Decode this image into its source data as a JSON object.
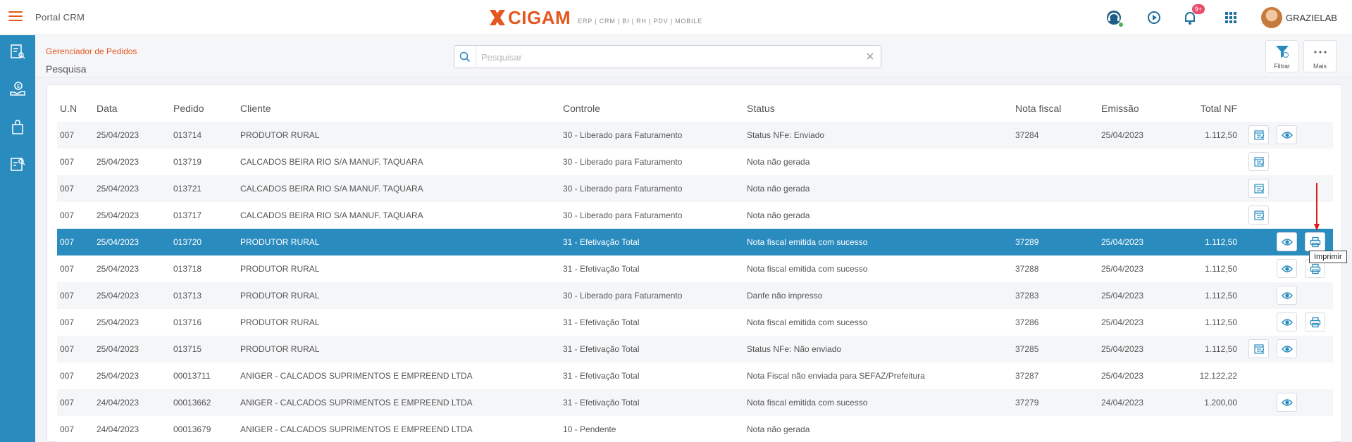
{
  "app": {
    "title": "Portal CRM",
    "brand": "CIGAM",
    "brand_tagline": "ERP | CRM | BI | RH | PDV | MOBILE",
    "accent": "#e4571e",
    "primary": "#2a8bbf"
  },
  "topbar": {
    "notifications_count": "9+",
    "user_name": "GRAZIELAB"
  },
  "header": {
    "breadcrumb": "Gerenciador de Pedidos",
    "title": "Pesquisa",
    "search_placeholder": "Pesquisar",
    "search_value": "",
    "filter_label": "Filtrar",
    "more_label": "Mais"
  },
  "table": {
    "columns": [
      "U.N",
      "Data",
      "Pedido",
      "Cliente",
      "Controle",
      "Status",
      "Nota fiscal",
      "Emissão",
      "Total NF"
    ],
    "rows": [
      {
        "un": "007",
        "data": "25/04/2023",
        "pedido": "013714",
        "cliente": "PRODUTOR RURAL",
        "controle": "30 - Liberado para Faturamento",
        "status": "Status NFe: Enviado",
        "nota": "37284",
        "emissao": "25/04/2023",
        "total": "1.112,50",
        "nfe": true,
        "view": true,
        "print": false,
        "selected": false
      },
      {
        "un": "007",
        "data": "25/04/2023",
        "pedido": "013719",
        "cliente": "CALCADOS BEIRA RIO S/A MANUF. TAQUARA",
        "controle": "30 - Liberado para Faturamento",
        "status": "Nota não gerada",
        "nota": "",
        "emissao": "",
        "total": "",
        "nfe": true,
        "view": false,
        "print": false,
        "selected": false
      },
      {
        "un": "007",
        "data": "25/04/2023",
        "pedido": "013721",
        "cliente": "CALCADOS BEIRA RIO S/A MANUF. TAQUARA",
        "controle": "30 - Liberado para Faturamento",
        "status": "Nota não gerada",
        "nota": "",
        "emissao": "",
        "total": "",
        "nfe": true,
        "view": false,
        "print": false,
        "selected": false
      },
      {
        "un": "007",
        "data": "25/04/2023",
        "pedido": "013717",
        "cliente": "CALCADOS BEIRA RIO S/A MANUF. TAQUARA",
        "controle": "30 - Liberado para Faturamento",
        "status": "Nota não gerada",
        "nota": "",
        "emissao": "",
        "total": "",
        "nfe": true,
        "view": false,
        "print": false,
        "selected": false
      },
      {
        "un": "007",
        "data": "25/04/2023",
        "pedido": "013720",
        "cliente": "PRODUTOR RURAL",
        "controle": "31 - Efetivação Total",
        "status": "Nota fiscal emitida com sucesso",
        "nota": "37289",
        "emissao": "25/04/2023",
        "total": "1.112,50",
        "nfe": false,
        "view": true,
        "print": true,
        "selected": true
      },
      {
        "un": "007",
        "data": "25/04/2023",
        "pedido": "013718",
        "cliente": "PRODUTOR RURAL",
        "controle": "31 - Efetivação Total",
        "status": "Nota fiscal emitida com sucesso",
        "nota": "37288",
        "emissao": "25/04/2023",
        "total": "1.112,50",
        "nfe": false,
        "view": true,
        "print": true,
        "selected": false
      },
      {
        "un": "007",
        "data": "25/04/2023",
        "pedido": "013713",
        "cliente": "PRODUTOR RURAL",
        "controle": "30 - Liberado para Faturamento",
        "status": "Danfe não impresso",
        "nota": "37283",
        "emissao": "25/04/2023",
        "total": "1.112,50",
        "nfe": false,
        "view": true,
        "print": false,
        "selected": false
      },
      {
        "un": "007",
        "data": "25/04/2023",
        "pedido": "013716",
        "cliente": "PRODUTOR RURAL",
        "controle": "31 - Efetivação Total",
        "status": "Nota fiscal emitida com sucesso",
        "nota": "37286",
        "emissao": "25/04/2023",
        "total": "1.112,50",
        "nfe": false,
        "view": true,
        "print": true,
        "selected": false
      },
      {
        "un": "007",
        "data": "25/04/2023",
        "pedido": "013715",
        "cliente": "PRODUTOR RURAL",
        "controle": "31 - Efetivação Total",
        "status": "Status NFe: Não enviado",
        "nota": "37285",
        "emissao": "25/04/2023",
        "total": "1.112,50",
        "nfe": true,
        "view": true,
        "print": false,
        "selected": false
      },
      {
        "un": "007",
        "data": "25/04/2023",
        "pedido": "00013711",
        "cliente": "ANIGER - CALCADOS SUPRIMENTOS E EMPREEND LTDA",
        "controle": "31 - Efetivação Total",
        "status": "Nota Fiscal não enviada para SEFAZ/Prefeitura",
        "nota": "37287",
        "emissao": "25/04/2023",
        "total": "12.122,22",
        "nfe": false,
        "view": false,
        "print": false,
        "selected": false
      },
      {
        "un": "007",
        "data": "24/04/2023",
        "pedido": "00013662",
        "cliente": "ANIGER - CALCADOS SUPRIMENTOS E EMPREEND LTDA",
        "controle": "31 - Efetivação Total",
        "status": "Nota fiscal emitida com sucesso",
        "nota": "37279",
        "emissao": "24/04/2023",
        "total": "1.200,00",
        "nfe": false,
        "view": true,
        "print": false,
        "selected": false
      },
      {
        "un": "007",
        "data": "24/04/2023",
        "pedido": "00013679",
        "cliente": "ANIGER - CALCADOS SUPRIMENTOS E EMPREEND LTDA",
        "controle": "10 - Pendente",
        "status": "Nota não gerada",
        "nota": "",
        "emissao": "",
        "total": "",
        "nfe": false,
        "view": false,
        "print": false,
        "selected": false
      }
    ]
  },
  "tooltip": {
    "text": "Imprimir"
  },
  "icons": {
    "menu": "hamburger-icon",
    "support": "headset-icon",
    "play": "play-icon",
    "bell": "bell-icon",
    "apps": "grid-icon",
    "orders": "orders-icon",
    "finance": "money-hand-icon",
    "bag": "bag-icon",
    "report": "report-search-icon",
    "nfe": "nfe-icon",
    "view": "eye-icon",
    "print": "printer-icon",
    "filter": "funnel-icon",
    "more": "dots-icon",
    "search": "search-icon",
    "clear": "close-icon"
  }
}
